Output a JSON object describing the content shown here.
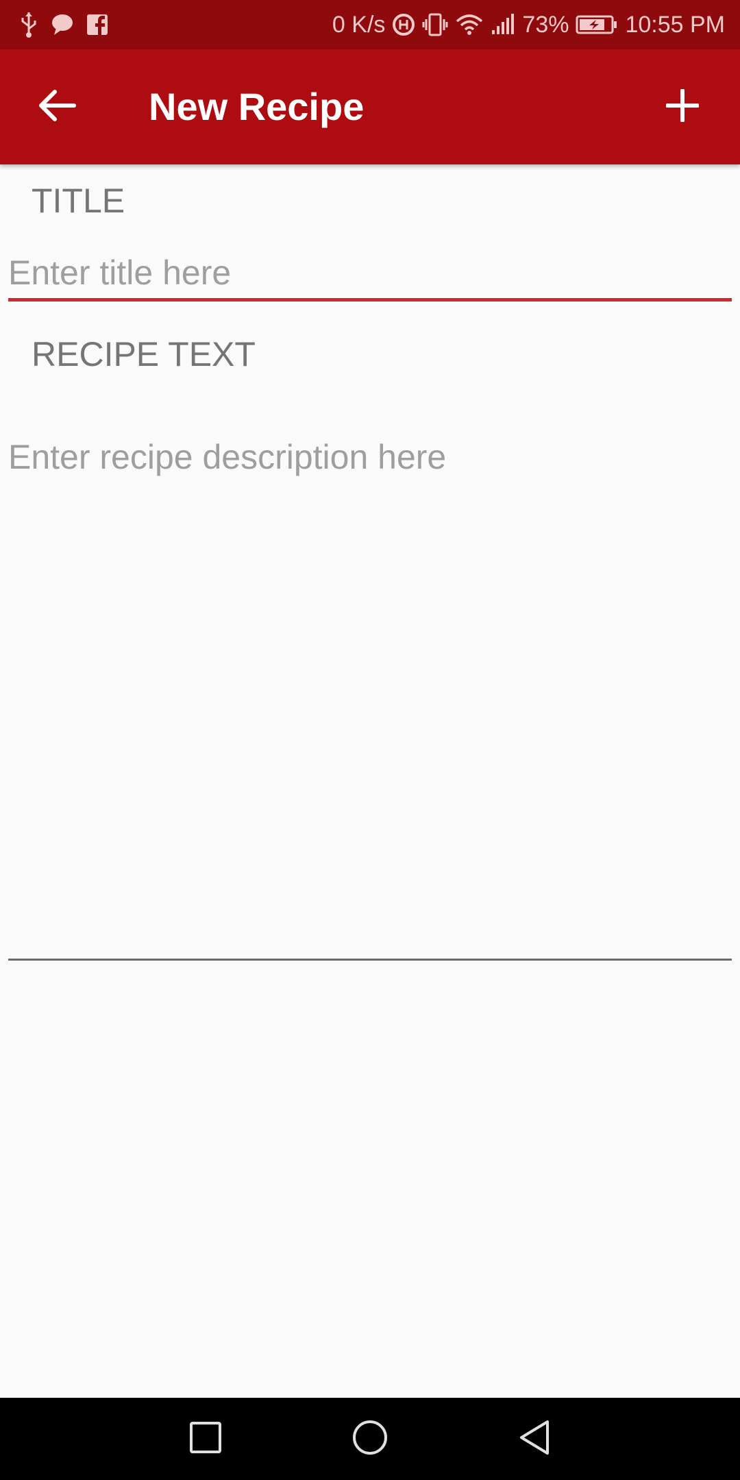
{
  "status_bar": {
    "net_speed": "0 K/s",
    "battery": "73%",
    "time": "10:55 PM",
    "icons": [
      "usb-icon",
      "chat-bubble-icon",
      "facebook-icon",
      "data-saver-icon",
      "vibrate-icon",
      "wifi-icon",
      "signal-icon",
      "battery-charging-icon"
    ]
  },
  "app_bar": {
    "title": "New Recipe",
    "back_icon": "arrow-left-icon",
    "add_icon": "plus-icon",
    "background": "#ad0d10"
  },
  "form": {
    "title_label": "TITLE",
    "title_placeholder": "Enter title here",
    "title_value": "",
    "recipe_label": "RECIPE TEXT",
    "recipe_placeholder": "Enter recipe description here",
    "recipe_value": "",
    "accent": "#d0262c"
  },
  "nav_bar": {
    "buttons": [
      "recents-square-icon",
      "home-circle-icon",
      "back-triangle-icon"
    ]
  }
}
